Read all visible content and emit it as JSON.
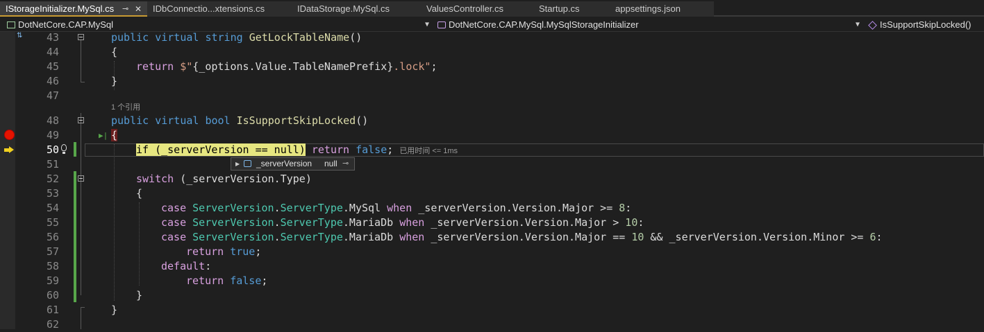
{
  "tabs": [
    {
      "label": "IStorageInitializer.MySql.cs",
      "active": true,
      "pin": "⊸",
      "close": "✕"
    },
    {
      "label": "IDbConnectio...xtensions.cs",
      "active": false
    },
    {
      "label": "IDataStorage.MySql.cs",
      "active": false
    },
    {
      "label": "ValuesController.cs",
      "active": false
    },
    {
      "label": "Startup.cs",
      "active": false
    },
    {
      "label": "appsettings.json",
      "active": false
    }
  ],
  "nav": {
    "project": "DotNetCore.CAP.MySql",
    "type": "DotNetCore.CAP.MySql.MySqlStorageInitializer",
    "member": "IsSupportSkipLocked()",
    "dropdown_glyph": "▼"
  },
  "editor": {
    "top_glyph": "⇅",
    "code_lens": "1 个引用",
    "elapsed": "已用时间 <= 1ms",
    "run_to_cursor": "▶|",
    "line_numbers": [
      "43",
      "44",
      "45",
      "46",
      "47",
      "48",
      "49",
      "50",
      "51",
      "52",
      "53",
      "54",
      "55",
      "56",
      "57",
      "58",
      "59",
      "60",
      "61",
      "62"
    ],
    "l43": {
      "a": "public",
      "b": "virtual",
      "c": "string",
      "d": "GetLockTableName",
      "e": "()"
    },
    "l44": {
      "a": "{"
    },
    "l45": {
      "a": "return",
      "b": " $\"",
      "c": "{_options.Value.TableNamePrefix}",
      "d": ".lock\"",
      "e": ";"
    },
    "l46": {
      "a": "}"
    },
    "l48": {
      "a": "public",
      "b": "virtual",
      "c": "bool",
      "d": "IsSupportSkipLocked",
      "e": "()"
    },
    "l49": {
      "a": "{"
    },
    "l50": {
      "a": "if (_serverVersion == null)",
      "b": "return",
      "c": "false",
      "d": ";"
    },
    "l52": {
      "a": "switch",
      "b": " (_serverVersion.Type)"
    },
    "l53": {
      "a": "{"
    },
    "l54": {
      "a": "case",
      "b": "ServerVersion",
      "c": ".",
      "d": "ServerType",
      "e": ".MySql",
      "f": "when",
      "g": " _serverVersion.Version.Major >= ",
      "h": "8",
      "i": ":"
    },
    "l55": {
      "a": "case",
      "b": "ServerVersion",
      "c": ".",
      "d": "ServerType",
      "e": ".MariaDb",
      "f": "when",
      "g": " _serverVersion.Version.Major > ",
      "h": "10",
      "i": ":"
    },
    "l56": {
      "a": "case",
      "b": "ServerVersion",
      "c": ".",
      "d": "ServerType",
      "e": ".MariaDb",
      "f": "when",
      "g": " _serverVersion.Version.Major == ",
      "h": "10",
      "i": " && _serverVersion.Version.Minor >= ",
      "j": "6",
      "k": ":"
    },
    "l57": {
      "a": "return",
      "b": "true",
      "c": ";"
    },
    "l58": {
      "a": "default",
      "b": ":"
    },
    "l59": {
      "a": "return",
      "b": "false",
      "c": ";"
    },
    "l60": {
      "a": "}"
    },
    "l61": {
      "a": "}"
    }
  },
  "datatip": {
    "expand": "▶",
    "name": "_serverVersion",
    "value": "null",
    "pin_glyph": "⊸"
  },
  "colors": {
    "background": "#1f1f1f",
    "keyword": "#569cd6",
    "control_keyword": "#d8a0df",
    "type": "#4ec9b0",
    "method": "#dcdcaa",
    "string": "#d69d85",
    "number": "#b5cea8",
    "breakpoint": "#e51400",
    "current_statement": "#e6e680",
    "active_tab_accent": "#c89a32",
    "changed_line_bar": "#57a64a"
  }
}
